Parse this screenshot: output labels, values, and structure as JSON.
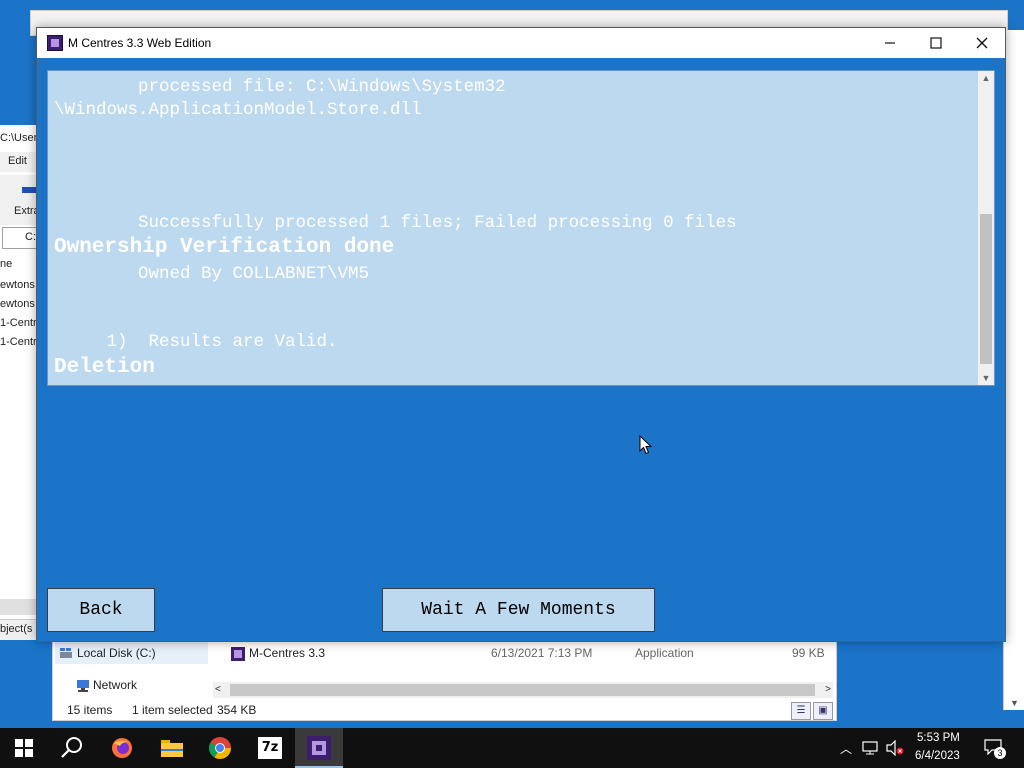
{
  "background": {
    "left_window": {
      "path": "C:\\User",
      "menu_edit": "Edit",
      "toolbar_label": "Extra",
      "address": "C:",
      "items": [
        "ne",
        "ewtons",
        "ewtons",
        "1-Centr",
        "1-Centr"
      ],
      "status": "bject(s"
    }
  },
  "explorer": {
    "nav_local_disk": "Local Disk (C:)",
    "nav_network": "Network",
    "file_name": "M-Centres 3.3",
    "file_date": "6/13/2021 7:13 PM",
    "file_type": "Application",
    "file_size": "99 KB",
    "status_items": "15 items",
    "status_selected": "1 item selected",
    "status_size": "354 KB"
  },
  "app": {
    "title": "M Centres 3.3 Web Edition",
    "console_lines": [
      "        processed file: C:\\Windows\\System32",
      "\\Windows.ApplicationModel.Store.dll",
      "        Successfully processed 1 files; Failed processing 0 files",
      "Ownership Verification done",
      "        Owned By COLLABNET\\VM5",
      "     1)  Results are Valid.",
      "Deletion"
    ],
    "back_label": "Back",
    "wait_label": "Wait A Few Moments"
  },
  "taskbar": {
    "time": "5:53 PM",
    "date": "6/4/2023",
    "notification_count": "3",
    "archiver_label": "7z"
  },
  "colors": {
    "desktop_blue": "#1c74c8",
    "console_bg": "#bcd9f0",
    "taskbar": "#101010"
  }
}
